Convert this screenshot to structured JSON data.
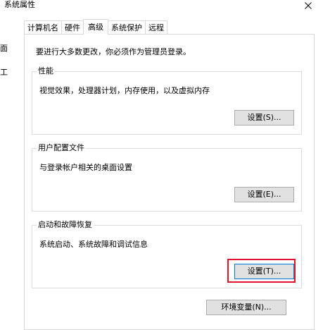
{
  "window": {
    "title": "系统属性"
  },
  "background_fragments": [
    "面",
    "工"
  ],
  "tabs": [
    {
      "label": "计算机名",
      "active": false
    },
    {
      "label": "硬件",
      "active": false
    },
    {
      "label": "高级",
      "active": true
    },
    {
      "label": "系统保护",
      "active": false
    },
    {
      "label": "远程",
      "active": false
    }
  ],
  "advanced": {
    "intro": "要进行大多数更改，你必须作为管理员登录。",
    "performance": {
      "title": "性能",
      "description": "视觉效果，处理器计划，内存使用，以及虚拟内存",
      "button_label": "设置(S)..."
    },
    "user_profiles": {
      "title": "用户配置文件",
      "description": "与登录帐户相关的桌面设置",
      "button_label": "设置(E)..."
    },
    "startup_recovery": {
      "title": "启动和故障恢复",
      "description": "系统启动、系统故障和调试信息",
      "button_label": "设置(T)...",
      "highlight_color": "#e0142c"
    },
    "env_button_label": "环境变量(N)..."
  },
  "colors": {
    "focus_border": "#0078d7",
    "button_face": "#e1e1e1",
    "button_border": "#adadad"
  }
}
